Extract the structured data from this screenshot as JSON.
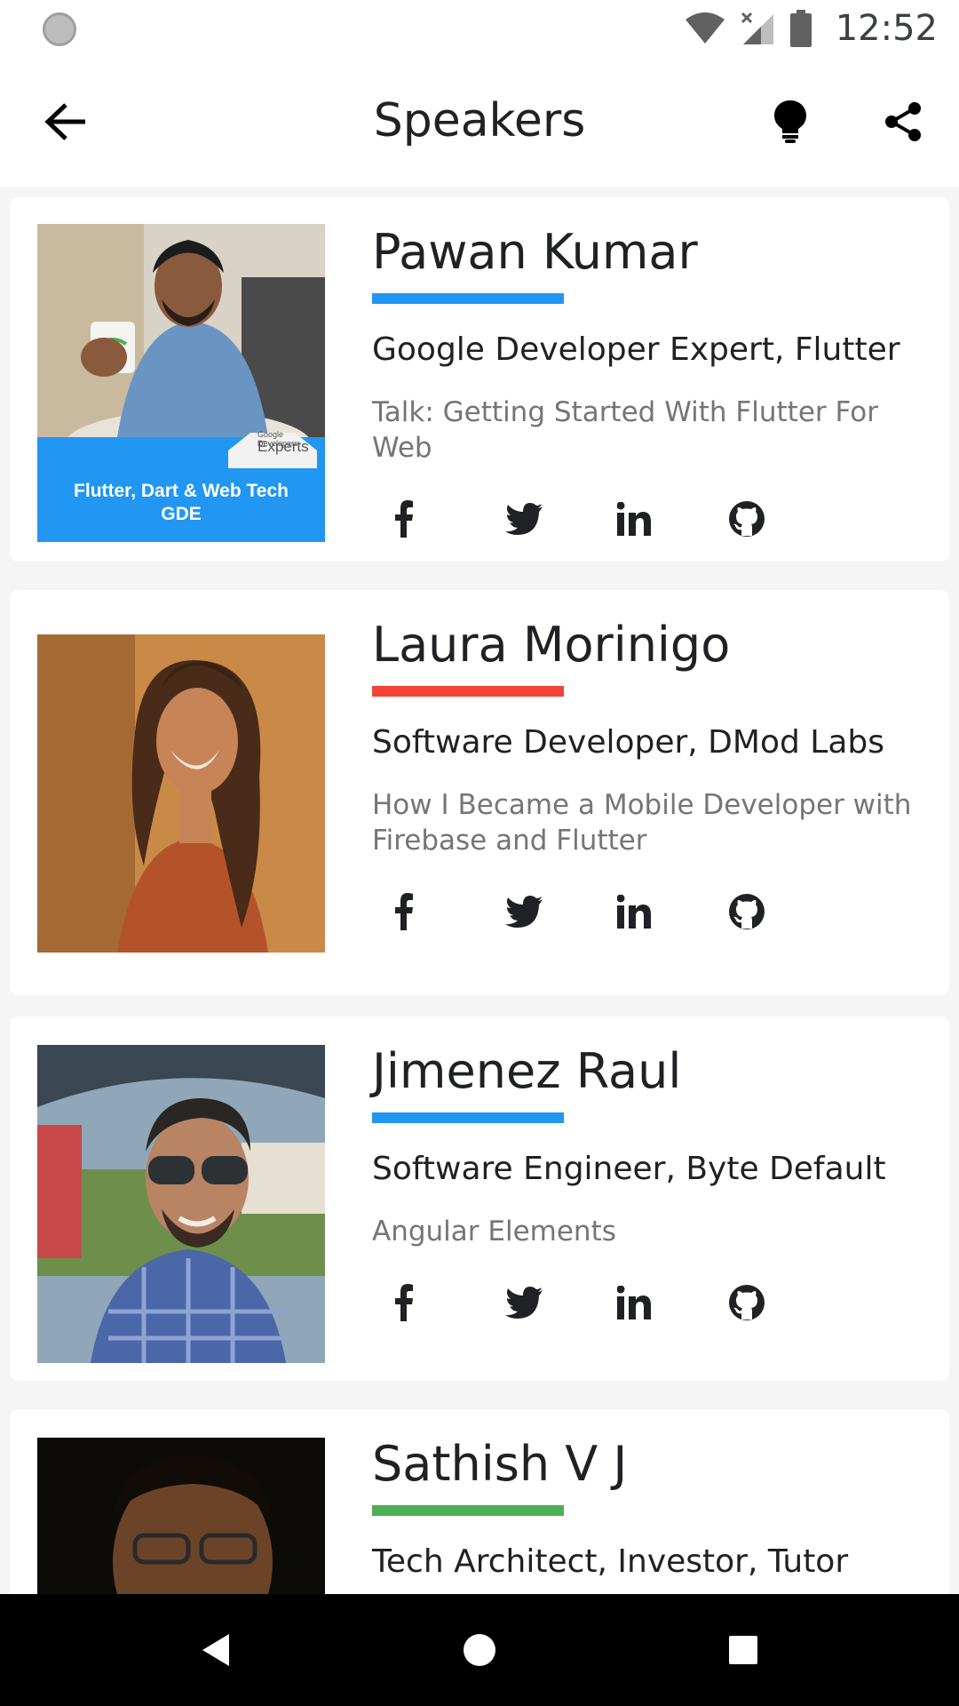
{
  "status_bar": {
    "time": "12:52"
  },
  "app_bar": {
    "title": "Speakers"
  },
  "speakers": [
    {
      "name": "Pawan Kumar",
      "role": "Google Developer Expert, Flutter",
      "talk": "Talk: Getting Started With Flutter For Web",
      "accent_color": "#2196f3",
      "photo_caption": "Flutter, Dart & Web Tech GDE",
      "photo_badge": "Experts",
      "photo_badge_sub": "Google Developers"
    },
    {
      "name": "Laura Morinigo",
      "role": "Software Developer, DMod Labs",
      "talk": "How I Became a Mobile Developer with Firebase and Flutter",
      "accent_color": "#f44336"
    },
    {
      "name": "Jimenez Raul",
      "role": "Software Engineer, Byte Default",
      "talk": "Angular Elements",
      "accent_color": "#2196f3"
    },
    {
      "name": "Sathish V J",
      "role": "Tech Architect, Investor, Tutor",
      "accent_color": "#4caf50"
    }
  ],
  "social_icons": [
    "facebook-icon",
    "twitter-icon",
    "linkedin-icon",
    "github-icon"
  ]
}
